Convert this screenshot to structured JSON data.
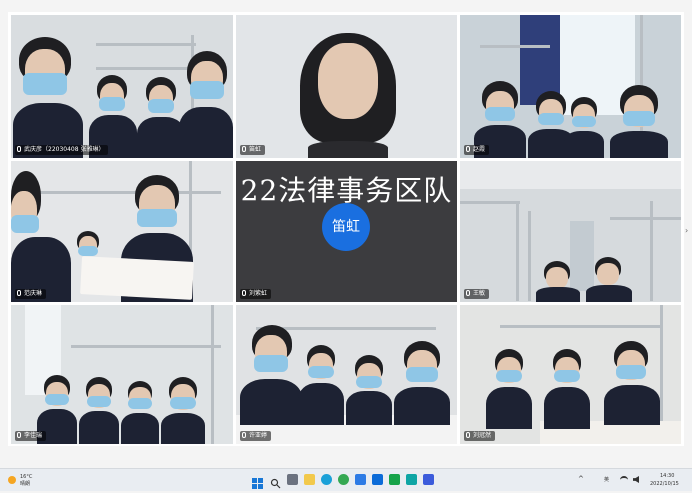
{
  "meeting": {
    "team_title": "22法律事务区队",
    "center_avatar_text": "笛虹"
  },
  "tiles": [
    {
      "id": "t1",
      "name": "武庆彦（22030408 张雅琳）"
    },
    {
      "id": "t2",
      "name": "笛虹"
    },
    {
      "id": "t3",
      "name": "赵霞"
    },
    {
      "id": "t4",
      "name": "范庆琳"
    },
    {
      "id": "t5",
      "name": "刘紫虹"
    },
    {
      "id": "t6",
      "name": "王敏"
    },
    {
      "id": "t7",
      "name": "李佳瑞"
    },
    {
      "id": "t8",
      "name": "许亚婷"
    },
    {
      "id": "t9",
      "name": "刘冠然"
    }
  ],
  "taskbar": {
    "weather_temp": "16°C",
    "weather_desc": "晴朗",
    "input_method": "英",
    "time": "14:30",
    "date": "2022/10/15"
  },
  "colors": {
    "avatar_bg": "#1a6fe0",
    "center_bg": "#3c3c3f",
    "taskbar_bg": "#e9edf2"
  }
}
